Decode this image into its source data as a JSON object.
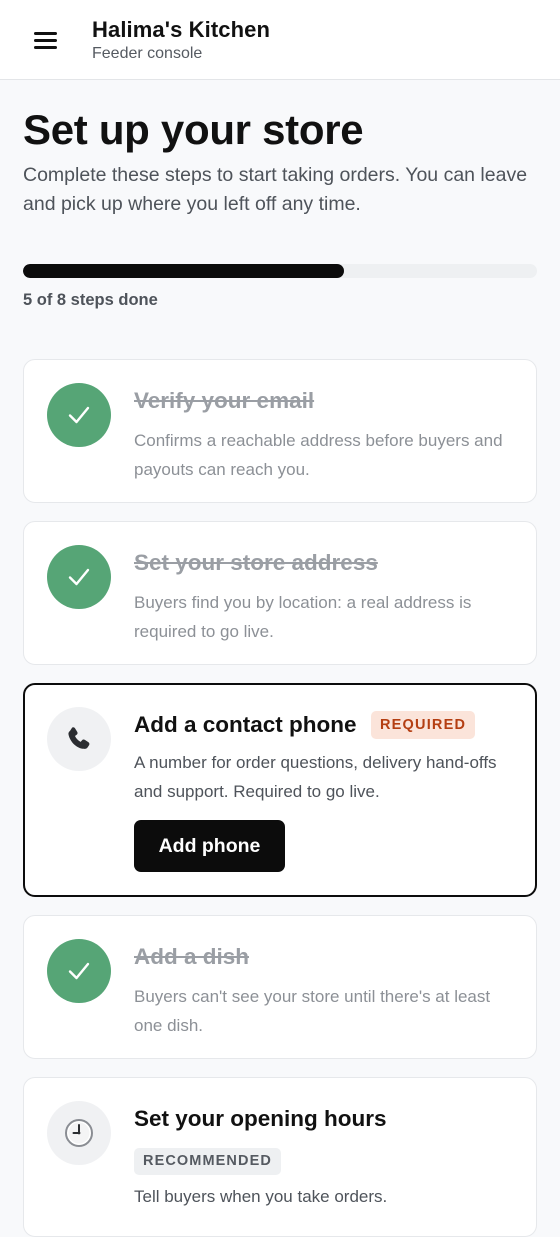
{
  "header": {
    "title": "Halima's Kitchen",
    "subtitle": "Feeder console",
    "menu_icon": "hamburger-menu-icon"
  },
  "page": {
    "title": "Set up your store",
    "intro": "Complete these steps to start taking orders. You can leave and pick up where you left off any time."
  },
  "progress": {
    "completed": 5,
    "total": 8,
    "fraction": 0.625,
    "label": "5 of 8 steps done"
  },
  "steps": [
    {
      "title": "Verify your email",
      "description": "Confirms a reachable address before buyers and payouts can reach you.",
      "status": "done",
      "icon": "checkmark-icon"
    },
    {
      "title": "Set your store address",
      "description": "Buyers find you by location: a real address is required to go live.",
      "status": "done",
      "icon": "checkmark-icon"
    },
    {
      "title": "Add a contact phone",
      "badge": "REQUIRED",
      "description": "A number for order questions, delivery hand-offs and support. Required to go live.",
      "status": "active",
      "icon": "phone-icon",
      "action_label": "Add phone"
    },
    {
      "title": "Add a dish",
      "description": "Buyers can't see your store until there's at least one dish.",
      "status": "done",
      "icon": "checkmark-icon"
    },
    {
      "title": "Set your opening hours",
      "badge": "RECOMMENDED",
      "description": "Tell buyers when you take orders.",
      "status": "todo",
      "icon": "clock-icon"
    }
  ],
  "colors": {
    "done": "#56a576",
    "required_badge_bg": "#fbe4da",
    "required_badge_text": "#b43e12",
    "primary": "#0c0c0c"
  }
}
